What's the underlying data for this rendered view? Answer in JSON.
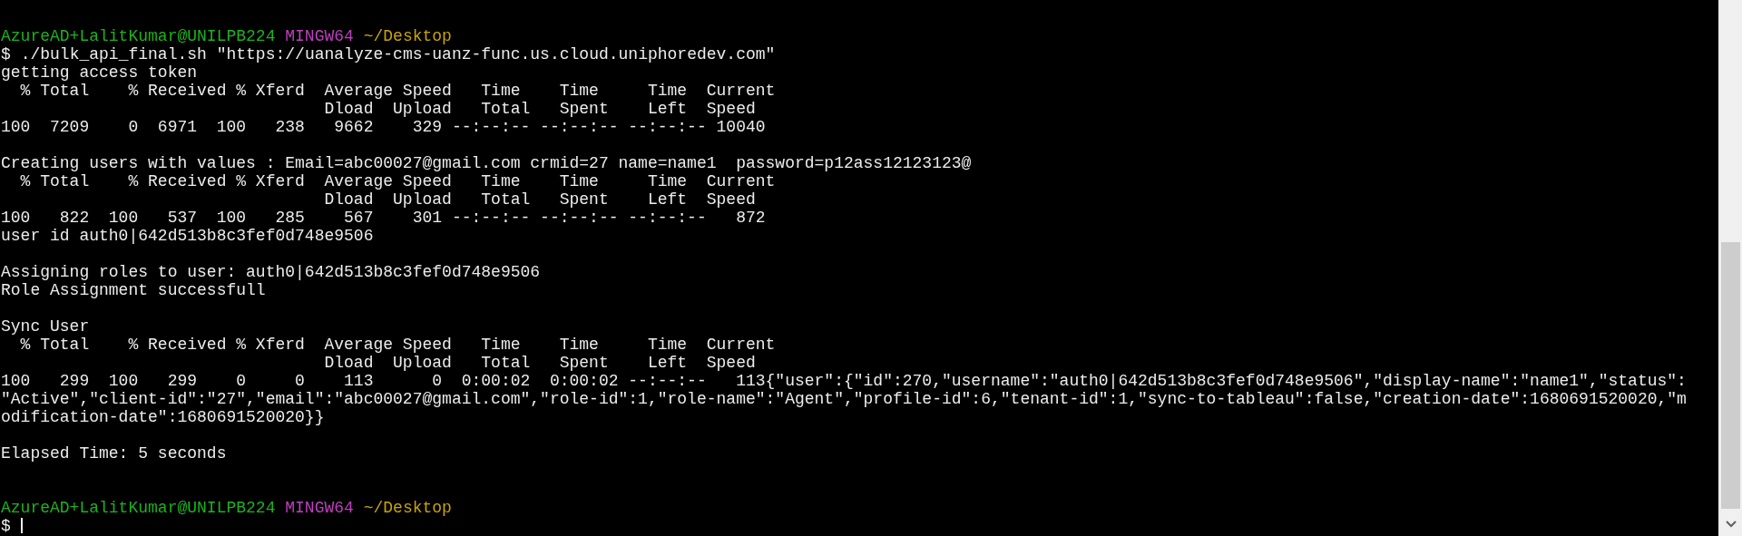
{
  "terminal": {
    "lines": [
      {
        "kind": "prompt",
        "user": "AzureAD+LalitKumar@UNILPB224",
        "shell": "MINGW64",
        "path": "~/Desktop"
      },
      {
        "kind": "command",
        "prompt": "$",
        "text": "./bulk_api_final.sh \"https://uanalyze-cms-uanz-func.us.cloud.uniphoredev.com\""
      },
      {
        "kind": "output",
        "text": "getting access token"
      },
      {
        "kind": "output",
        "text": "  % Total    % Received % Xferd  Average Speed   Time    Time     Time  Current"
      },
      {
        "kind": "output",
        "text": "                                 Dload  Upload   Total   Spent    Left  Speed"
      },
      {
        "kind": "output",
        "text": "100  7209    0  6971  100   238   9662    329 --:--:-- --:--:-- --:--:-- 10040"
      },
      {
        "kind": "blank"
      },
      {
        "kind": "output",
        "text": "Creating users with values : Email=abc00027@gmail.com crmid=27 name=name1  password=p12ass12123123@"
      },
      {
        "kind": "output",
        "text": "  % Total    % Received % Xferd  Average Speed   Time    Time     Time  Current"
      },
      {
        "kind": "output",
        "text": "                                 Dload  Upload   Total   Spent    Left  Speed"
      },
      {
        "kind": "output",
        "text": "100   822  100   537  100   285    567    301 --:--:-- --:--:-- --:--:--   872"
      },
      {
        "kind": "output",
        "text": "user id auth0|642d513b8c3fef0d748e9506"
      },
      {
        "kind": "blank"
      },
      {
        "kind": "output",
        "text": "Assigning roles to user: auth0|642d513b8c3fef0d748e9506"
      },
      {
        "kind": "output",
        "text": "Role Assignment successfull"
      },
      {
        "kind": "blank"
      },
      {
        "kind": "output",
        "text": "Sync User"
      },
      {
        "kind": "output",
        "text": "  % Total    % Received % Xferd  Average Speed   Time    Time     Time  Current"
      },
      {
        "kind": "output",
        "text": "                                 Dload  Upload   Total   Spent    Left  Speed"
      },
      {
        "kind": "output",
        "text": "100   299  100   299    0     0    113      0  0:00:02  0:00:02 --:--:--   113{\"user\":{\"id\":270,\"username\":\"auth0|642d513b8c3fef0d748e9506\",\"display-name\":\"name1\",\"status\":"
      },
      {
        "kind": "output",
        "text": "\"Active\",\"client-id\":\"27\",\"email\":\"abc00027@gmail.com\",\"role-id\":1,\"role-name\":\"Agent\",\"profile-id\":6,\"tenant-id\":1,\"sync-to-tableau\":false,\"creation-date\":1680691520020,\"m"
      },
      {
        "kind": "output",
        "text": "odification-date\":1680691520020}}"
      },
      {
        "kind": "blank"
      },
      {
        "kind": "output",
        "text": "Elapsed Time: 5 seconds"
      },
      {
        "kind": "blank"
      },
      {
        "kind": "blank"
      },
      {
        "kind": "prompt",
        "user": "AzureAD+LalitKumar@UNILPB224",
        "shell": "MINGW64",
        "path": "~/Desktop"
      },
      {
        "kind": "input",
        "prompt": "$"
      }
    ]
  }
}
